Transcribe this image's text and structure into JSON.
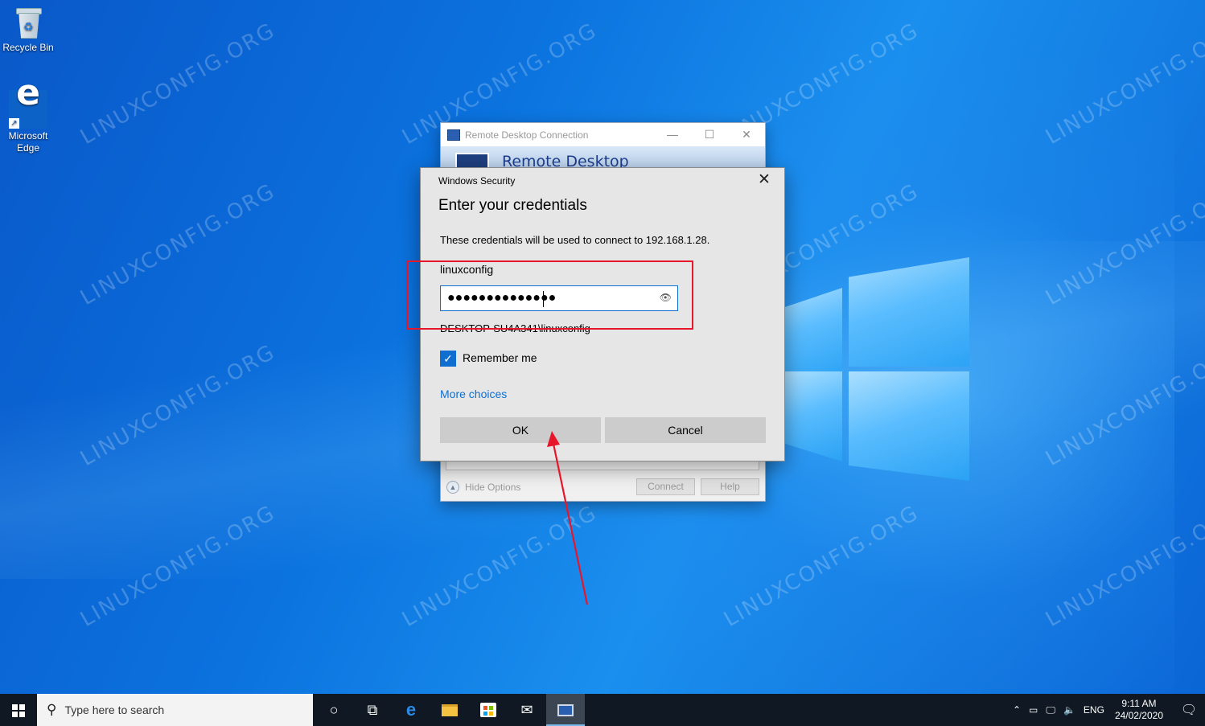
{
  "desktop": {
    "icons": [
      {
        "label": "Recycle Bin"
      },
      {
        "label": "Microsoft Edge"
      }
    ],
    "watermark": "LINUXCONFIG.ORG"
  },
  "rdp_window": {
    "title": "Remote Desktop Connection",
    "banner": "Remote Desktop",
    "hide_options": "Hide Options",
    "connect": "Connect",
    "help": "Help"
  },
  "security_dialog": {
    "caption": "Windows Security",
    "heading": "Enter your credentials",
    "description": "These credentials will be used to connect to 192.168.1.28.",
    "username": "linuxconfig",
    "password_mask": "●●●●●●●●●●●●●●",
    "domain_user": "DESKTOP-SU4A341\\linuxconfig",
    "remember_me": {
      "label": "Remember me",
      "checked": true
    },
    "more_choices": "More choices",
    "ok": "OK",
    "cancel": "Cancel",
    "close": "✕"
  },
  "taskbar": {
    "search_placeholder": "Type here to search",
    "tray_language": "ENG",
    "time": "9:11 AM",
    "date": "24/02/2020",
    "apps": [
      "cortana-icon",
      "task-view-icon",
      "edge-icon",
      "file-explorer-icon",
      "store-icon",
      "mail-icon",
      "remote-desktop-icon"
    ]
  },
  "colors": {
    "accent": "#0e6fd0",
    "highlight": "#e8162a",
    "taskbar": "#101923"
  }
}
